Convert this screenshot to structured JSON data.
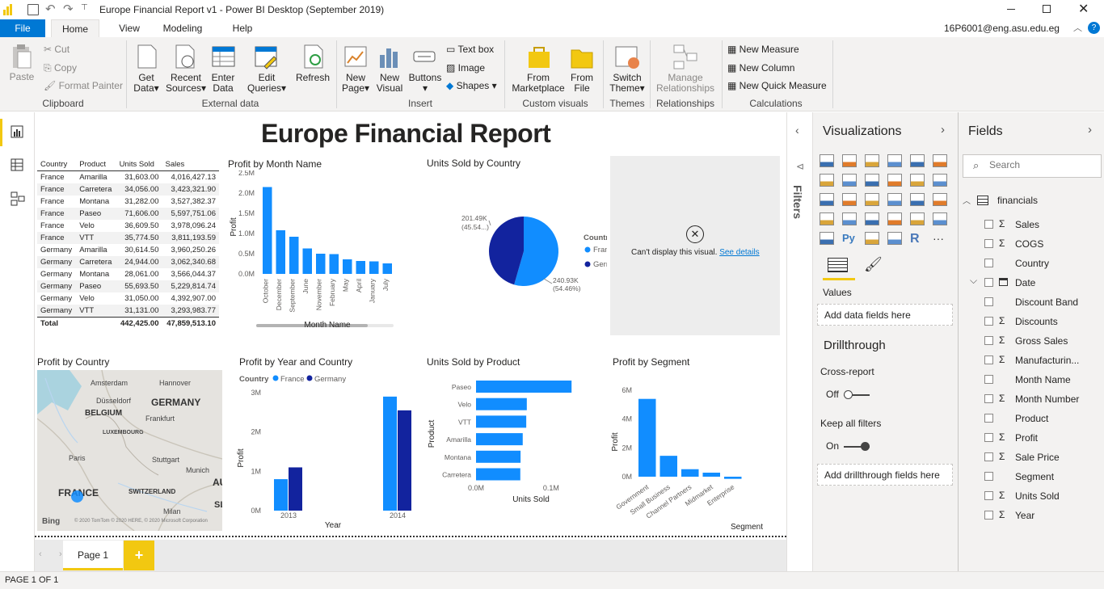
{
  "window": {
    "title": "Europe Financial Report v1 - Power BI Desktop (September 2019)"
  },
  "menu": {
    "file": "File",
    "tabs": [
      "Home",
      "View",
      "Modeling",
      "Help"
    ],
    "user": "16P6001@eng.asu.edu.eg"
  },
  "ribbon": {
    "paste": "Paste",
    "cut": "Cut",
    "copy": "Copy",
    "format_painter": "Format Painter",
    "clipboard": "Clipboard",
    "get_data": [
      "Get",
      "Data"
    ],
    "recent_sources": [
      "Recent",
      "Sources"
    ],
    "enter_data": [
      "Enter",
      "Data"
    ],
    "edit_queries": [
      "Edit",
      "Queries"
    ],
    "refresh": "Refresh",
    "external_data": "External data",
    "new_page": [
      "New",
      "Page"
    ],
    "new_visual": [
      "New",
      "Visual"
    ],
    "buttons": "Buttons",
    "text_box": "Text box",
    "image": "Image",
    "shapes": "Shapes",
    "insert": "Insert",
    "from_marketplace": [
      "From",
      "Marketplace"
    ],
    "from_file": [
      "From",
      "File"
    ],
    "custom_visuals": "Custom visuals",
    "switch_theme": [
      "Switch",
      "Theme"
    ],
    "themes": "Themes",
    "manage_relationships": [
      "Manage",
      "Relationships"
    ],
    "relationships": "Relationships",
    "new_measure": "New Measure",
    "new_column": "New Column",
    "new_quick_measure": "New Quick Measure",
    "calculations": "Calculations"
  },
  "report": {
    "title": "Europe Financial Report",
    "matrix": {
      "headers": [
        "Country",
        "Product",
        "Units Sold",
        "Sales"
      ],
      "rows": [
        [
          "France",
          "Amarilla",
          "31,603.00",
          "4,016,427.13"
        ],
        [
          "France",
          "Carretera",
          "34,056.00",
          "3,423,321.90"
        ],
        [
          "France",
          "Montana",
          "31,282.00",
          "3,527,382.37"
        ],
        [
          "France",
          "Paseo",
          "71,606.00",
          "5,597,751.06"
        ],
        [
          "France",
          "Velo",
          "36,609.50",
          "3,978,096.24"
        ],
        [
          "France",
          "VTT",
          "35,774.50",
          "3,811,193.59"
        ],
        [
          "Germany",
          "Amarilla",
          "30,614.50",
          "3,960,250.26"
        ],
        [
          "Germany",
          "Carretera",
          "24,944.00",
          "3,062,340.68"
        ],
        [
          "Germany",
          "Montana",
          "28,061.00",
          "3,566,044.37"
        ],
        [
          "Germany",
          "Paseo",
          "55,693.50",
          "5,229,814.74"
        ],
        [
          "Germany",
          "Velo",
          "31,050.00",
          "4,392,907.00"
        ],
        [
          "Germany",
          "VTT",
          "31,131.00",
          "3,293,983.77"
        ]
      ],
      "total": [
        "Total",
        "",
        "442,425.00",
        "47,859,513.10"
      ]
    },
    "month_chart_title": "Profit by Month Name",
    "pie_title": "Units Sold by Country",
    "error_msg": "Can't display this visual.",
    "error_link": "See details",
    "map_title": "Profit by Country",
    "map_labels": {
      "amsterdam": "Amsterdam",
      "hannover": "Hannover",
      "germany": "GERMANY",
      "dusseldorf": "Düsseldorf",
      "belgium": "BELGIUM",
      "frankfurt": "Frankfurt",
      "luxembourg": "LUXEMBOURG",
      "paris": "Paris",
      "stuttgart": "Stuttgart",
      "munich": "Munich",
      "france": "FRANCE",
      "switzerland": "SWITZERLAND",
      "milan": "Milan",
      "au": "AU",
      "sl": "SL",
      "bing": "Bing",
      "copyright": "© 2020 TomTom © 2020 HERE, © 2020 Microsoft Corporation"
    },
    "year_chart_title": "Profit by Year and Country",
    "product_chart_title": "Units Sold by Product",
    "segment_chart_title": "Profit by Segment"
  },
  "chart_data": [
    {
      "type": "bar",
      "title": "Profit by Month Name",
      "xlabel": "Month Name",
      "ylabel": "Profit",
      "categories": [
        "October",
        "December",
        "September",
        "June",
        "November",
        "February",
        "May",
        "April",
        "January",
        "July"
      ],
      "values": [
        2150000,
        1080000,
        920000,
        630000,
        500000,
        490000,
        360000,
        320000,
        310000,
        260000
      ],
      "ylim": [
        0,
        2500000
      ],
      "yticks": [
        "0.0M",
        "0.5M",
        "1.0M",
        "1.5M",
        "2.0M",
        "2.5M"
      ]
    },
    {
      "type": "pie",
      "title": "Units Sold by Country",
      "legend_title": "Country",
      "categories": [
        "France",
        "Germany"
      ],
      "values": [
        240930,
        201490
      ],
      "labels": [
        "240.93K\n(54.46%)",
        "201.49K\n(45.54...)"
      ]
    },
    {
      "type": "bar",
      "title": "Profit by Year and Country",
      "xlabel": "Year",
      "ylabel": "Profit",
      "legend_title": "Country",
      "categories": [
        "2013",
        "2014"
      ],
      "series": [
        {
          "name": "France",
          "values": [
            800000,
            2900000
          ]
        },
        {
          "name": "Germany",
          "values": [
            1100000,
            2550000
          ]
        }
      ],
      "ylim": [
        0,
        3000000
      ],
      "yticks": [
        "0M",
        "1M",
        "2M",
        "3M"
      ]
    },
    {
      "type": "bar",
      "title": "Units Sold by Product",
      "orientation": "horizontal",
      "xlabel": "Units Sold",
      "ylabel": "Product",
      "categories": [
        "Paseo",
        "Velo",
        "VTT",
        "Amarilla",
        "Montana",
        "Carretera"
      ],
      "values": [
        127300,
        67660,
        66906,
        62218,
        59343,
        59000
      ],
      "xlim": [
        0,
        140000
      ],
      "xticks": [
        "0.0M",
        "0.1M"
      ]
    },
    {
      "type": "bar",
      "title": "Profit by Segment",
      "xlabel": "Segment",
      "ylabel": "Profit",
      "categories": [
        "Government",
        "Small Business",
        "Channel Partners",
        "Midmarket",
        "Enterprise"
      ],
      "values": [
        5400000,
        1450000,
        520000,
        280000,
        -150000
      ],
      "ylim": [
        -300000,
        6000000
      ],
      "yticks": [
        "0M",
        "2M",
        "4M",
        "6M"
      ]
    }
  ],
  "filters_label": "Filters",
  "visualizations": {
    "title": "Visualizations",
    "values_label": "Values",
    "values_placeholder": "Add data fields here",
    "drillthrough": "Drillthrough",
    "cross_report": "Cross-report",
    "off": "Off",
    "keep_filters": "Keep all filters",
    "on": "On",
    "drill_placeholder": "Add drillthrough fields here"
  },
  "fields": {
    "title": "Fields",
    "search_placeholder": "Search",
    "table": "financials",
    "items": [
      {
        "name": "Sales",
        "sigma": "Σ"
      },
      {
        "name": "COGS",
        "sigma": "Σ"
      },
      {
        "name": "Country",
        "sigma": ""
      },
      {
        "name": "Date",
        "sigma": ""
      },
      {
        "name": "Discount Band",
        "sigma": ""
      },
      {
        "name": "Discounts",
        "sigma": "Σ"
      },
      {
        "name": "Gross Sales",
        "sigma": "Σ"
      },
      {
        "name": "Manufacturin...",
        "sigma": "Σ"
      },
      {
        "name": "Month Name",
        "sigma": ""
      },
      {
        "name": "Month Number",
        "sigma": "Σ"
      },
      {
        "name": "Product",
        "sigma": ""
      },
      {
        "name": "Profit",
        "sigma": "Σ"
      },
      {
        "name": "Sale Price",
        "sigma": "Σ"
      },
      {
        "name": "Segment",
        "sigma": ""
      },
      {
        "name": "Units Sold",
        "sigma": "Σ"
      },
      {
        "name": "Year",
        "sigma": "Σ"
      }
    ]
  },
  "pages": {
    "tab": "Page 1",
    "add": "+"
  },
  "status": "PAGE 1 OF 1",
  "colors": {
    "accent": "#f2c811",
    "blue1": "#118dff",
    "blue2": "#12239e",
    "file_tab": "#0078d4"
  }
}
